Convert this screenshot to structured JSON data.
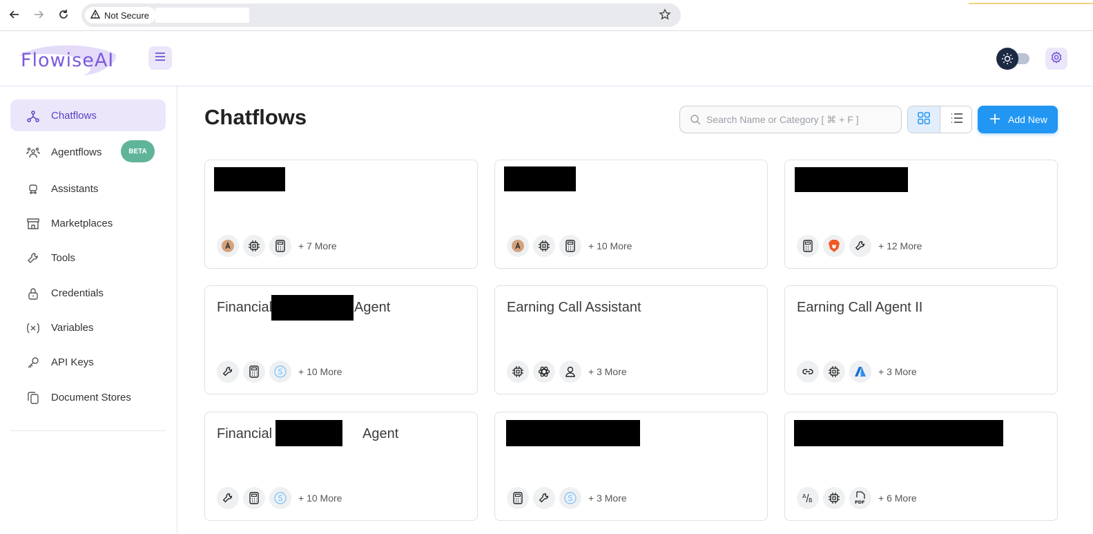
{
  "browser": {
    "security_label": "Not Secure",
    "icons": [
      "back-arrow-icon",
      "forward-arrow-icon",
      "reload-icon",
      "warning-icon",
      "star-icon"
    ]
  },
  "header": {
    "logo_text": "FlowiseAI",
    "icons": [
      "hamburger-menu-icon",
      "sun-icon",
      "gear-icon"
    ]
  },
  "sidebar": {
    "items": [
      {
        "label": "Chatflows",
        "icon": "chatflow-icon",
        "active": true
      },
      {
        "label": "Agentflows",
        "icon": "agents-icon",
        "badge": "BETA"
      },
      {
        "label": "Assistants",
        "icon": "robot-icon"
      },
      {
        "label": "Marketplaces",
        "icon": "store-icon"
      },
      {
        "label": "Tools",
        "icon": "wrench-icon"
      },
      {
        "label": "Credentials",
        "icon": "lock-icon"
      },
      {
        "label": "Variables",
        "icon": "variable-icon"
      },
      {
        "label": "API Keys",
        "icon": "key-icon"
      },
      {
        "label": "Document Stores",
        "icon": "documents-icon"
      }
    ]
  },
  "main": {
    "title": "Chatflows",
    "search": {
      "placeholder": "Search Name or Category [ ⌘ + F ]",
      "value": ""
    },
    "view_mode": "grid",
    "add_button_label": "Add New",
    "colors": {
      "accent": "#2196f3",
      "active_bg": "#ece6fb",
      "active_text": "#5b3fc4",
      "beta": "#5fb49a"
    },
    "cards": [
      {
        "title": "",
        "title_redacted": true,
        "icons": [
          "anthropic-icon",
          "chip-icon",
          "calculator-icon"
        ],
        "more": "+ 7 More"
      },
      {
        "title": "",
        "title_redacted": true,
        "icons": [
          "anthropic-icon",
          "chip-icon",
          "calculator-icon"
        ],
        "more": "+ 10 More"
      },
      {
        "title": "",
        "title_redacted": true,
        "icons": [
          "calculator-icon",
          "brave-icon",
          "wrench-icon"
        ],
        "more": "+ 12 More"
      },
      {
        "title_prefix": "Financial",
        "title_suffix": "Agent",
        "title_redacted_middle": true,
        "icons": [
          "wrench-icon",
          "calculator-icon",
          "serp-icon"
        ],
        "more": "+ 10 More"
      },
      {
        "title": "Earning Call Assistant",
        "icons": [
          "chip-icon",
          "openai-icon",
          "person-icon"
        ],
        "more": "+ 3 More"
      },
      {
        "title": "Earning Call Agent II",
        "icons": [
          "link-icon",
          "chip-icon",
          "azure-icon"
        ],
        "more": "+ 3 More"
      },
      {
        "title_prefix": "Financial",
        "title_suffix": "Agent",
        "title_redacted_middle": true,
        "icons": [
          "wrench-icon",
          "calculator-icon",
          "serp-icon"
        ],
        "more": "+ 10 More"
      },
      {
        "title": "",
        "title_redacted": true,
        "icons": [
          "calculator-icon",
          "wrench-icon",
          "serp-icon"
        ],
        "more": "+ 3 More"
      },
      {
        "title": "",
        "title_redacted": true,
        "icons": [
          "ab-split-icon",
          "chip-icon",
          "pdf-icon"
        ],
        "more": "+ 6 More"
      }
    ]
  }
}
